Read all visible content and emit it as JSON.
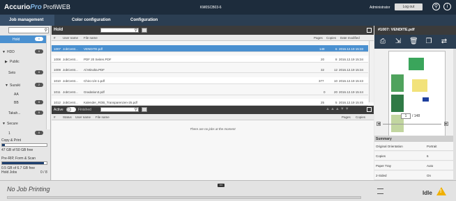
{
  "app": {
    "logo_brand": "Accurio",
    "logo_pro": "Pro",
    "logo_product": "ProfiWEB",
    "device_name": "KM0SCB03-6",
    "user": "Administrator",
    "logout_label": "Log out"
  },
  "nav": {
    "tabs": [
      {
        "label": "Job management",
        "active": true
      },
      {
        "label": "Color configuration",
        "active": false
      },
      {
        "label": "Configuration",
        "active": false
      }
    ]
  },
  "sidebar": {
    "items": [
      {
        "label": "Hold",
        "count": "6",
        "selected": true
      },
      {
        "label": "HDD",
        "count": "0",
        "expander": "▼"
      },
      {
        "label": "Public",
        "count": "",
        "expander": "▶"
      },
      {
        "label": "Seto",
        "count": "0"
      },
      {
        "label": "Suzuki",
        "count": "2",
        "expander": "▼"
      },
      {
        "label": "AA",
        "count": ""
      },
      {
        "label": "BB",
        "count": "0"
      },
      {
        "label": "Takah...",
        "count": "0"
      },
      {
        "label": "Secure",
        "count": "",
        "expander": "▼"
      },
      {
        "label": "1",
        "count": "0"
      }
    ],
    "copy_print_label": "Copy & Print",
    "copy_print_usage": "47 GB of 50 GB free",
    "copy_print_fill_percent": 6,
    "prerip_label": "Pre-RIP, Form & Scan",
    "prerip_usage": "0.5 GB of 6.7 GB free",
    "prerip_fill_percent": 93,
    "hold_jobs_label": "Hold Jobs",
    "hold_jobs_value": "0 / 8"
  },
  "hold": {
    "title": "Hold",
    "columns": {
      "num": "#",
      "user": "User name",
      "file": "File name",
      "pages": "Pages",
      "copies": "Copies",
      "date": "Date modified"
    },
    "rows": [
      {
        "num": "1007",
        "user": "JobCentr...",
        "file": "VENDITE.pdf",
        "pages": "148",
        "copies": "6",
        "date": "2016.12.19 15:33",
        "selected": true
      },
      {
        "num": "1008",
        "user": "JobCentr...",
        "file": "PDF 20 Seiten.PDF",
        "pages": "20",
        "copies": "8",
        "date": "2016.12.19 15:34"
      },
      {
        "num": "1009",
        "user": "JobCentr...",
        "file": "Al Minolta.PDF",
        "pages": "32",
        "copies": "12",
        "date": "2016.12.19 15:34"
      },
      {
        "num": "1010",
        "user": "JobCentr...",
        "file": "Chiro-1/4-1.pdf",
        "pages": "377",
        "copies": "10",
        "date": "2016.12.19 15:43"
      },
      {
        "num": "1011",
        "user": "JobCentr...",
        "file": "Gradation3.pdf",
        "pages": "0",
        "copies": "20",
        "date": "2016.12.19 15:44"
      },
      {
        "num": "1012",
        "user": "JobCentr...",
        "file": "Kalender_ROB_Transparenzen-25.pdf",
        "pages": "25",
        "copies": "5",
        "date": "2016.12.19 15:45"
      }
    ]
  },
  "active": {
    "title": "Active",
    "finished_label": "Finished",
    "columns": {
      "num": "#",
      "status": "Status",
      "user": "User name",
      "file": "File name",
      "pages": "Pages",
      "copies": "Copies"
    },
    "empty_text": "There are no jobs at the moment"
  },
  "preview": {
    "title": "#1007: VENDITE.pdf",
    "page_current": "1",
    "page_total": "/ 148",
    "summary_label": "Summary",
    "summary_rows": [
      {
        "key": "Original Orientation",
        "value": "Portrait"
      },
      {
        "key": "Copies",
        "value": "6"
      },
      {
        "key": "Paper Tray",
        "value": "Auto"
      },
      {
        "key": "2-Sided",
        "value": "On"
      }
    ]
  },
  "status": {
    "no_job_text": "No Job Printing",
    "idle_text": "Idle",
    "dots": "•••",
    "warning_glyph": "!"
  },
  "colors": {
    "accent": "#4a90d0",
    "topbar": "#1d2c3c",
    "navbar": "#2b3e52",
    "warning": "#f0b000"
  },
  "icons": [
    "search-icon",
    "calendar-icon",
    "maximize-icon",
    "print-icon",
    "export-icon",
    "delete-icon",
    "copy-icon",
    "move-icon",
    "info-icon",
    "user-search-icon",
    "warning-icon"
  ]
}
